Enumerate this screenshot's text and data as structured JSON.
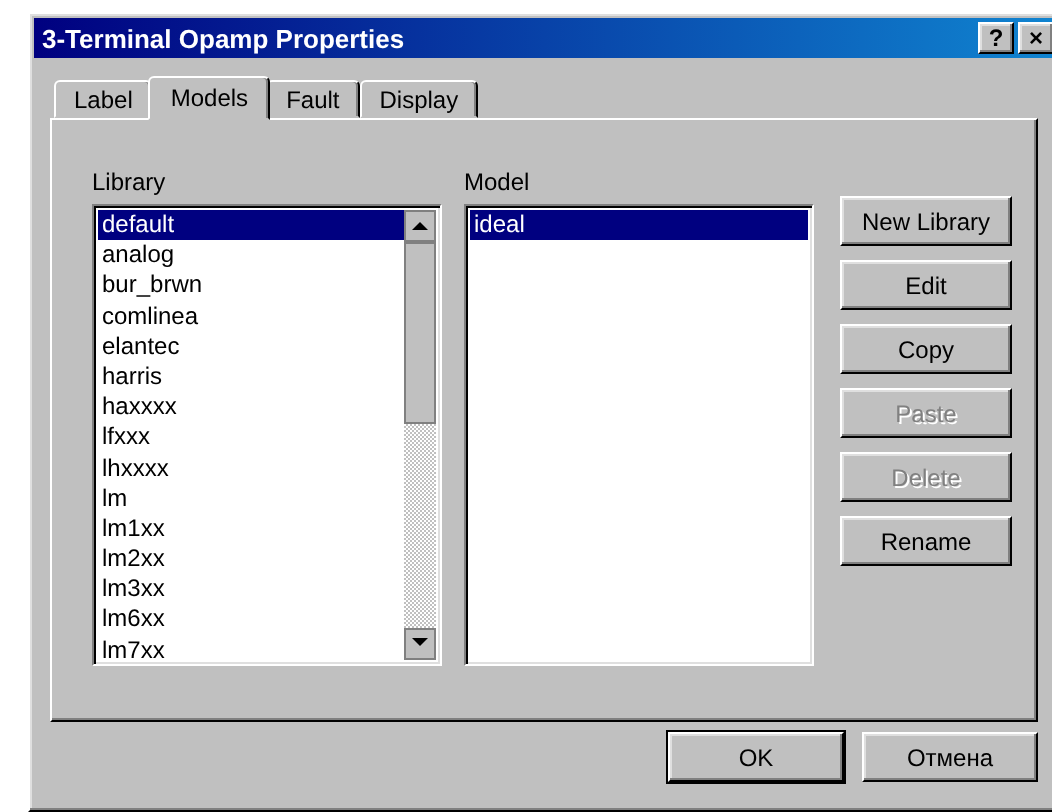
{
  "window": {
    "title": "3-Terminal Opamp Properties",
    "title_buttons": [
      "?",
      "×"
    ]
  },
  "tabs": [
    {
      "label": "Label",
      "selected": false
    },
    {
      "label": "Models",
      "selected": true
    },
    {
      "label": "Fault",
      "selected": false
    },
    {
      "label": "Display",
      "selected": false
    }
  ],
  "library": {
    "label": "Library",
    "items": [
      {
        "label": "default",
        "selected": true
      },
      {
        "label": "analog",
        "selected": false
      },
      {
        "label": "bur_brwn",
        "selected": false
      },
      {
        "label": "comlinea",
        "selected": false
      },
      {
        "label": "elantec",
        "selected": false
      },
      {
        "label": "harris",
        "selected": false
      },
      {
        "label": "haxxxx",
        "selected": false
      },
      {
        "label": "lfxxx",
        "selected": false
      },
      {
        "label": "lhxxxx",
        "selected": false
      },
      {
        "label": "lm",
        "selected": false
      },
      {
        "label": "lm1xx",
        "selected": false
      },
      {
        "label": "lm2xx",
        "selected": false
      },
      {
        "label": "lm3xx",
        "selected": false
      },
      {
        "label": "lm6xx",
        "selected": false
      },
      {
        "label": "lm7xx",
        "selected": false
      }
    ]
  },
  "model": {
    "label": "Model",
    "items": [
      {
        "label": "ideal",
        "selected": true
      }
    ]
  },
  "side_buttons": [
    {
      "label": "New Library",
      "disabled": false
    },
    {
      "label": "Edit",
      "disabled": false
    },
    {
      "label": "Copy",
      "disabled": false
    },
    {
      "label": "Paste",
      "disabled": true
    },
    {
      "label": "Delete",
      "disabled": true
    },
    {
      "label": "Rename",
      "disabled": false
    }
  ],
  "footer_buttons": [
    {
      "label": "OK",
      "default": true
    },
    {
      "label": "Отмена",
      "default": false
    }
  ]
}
